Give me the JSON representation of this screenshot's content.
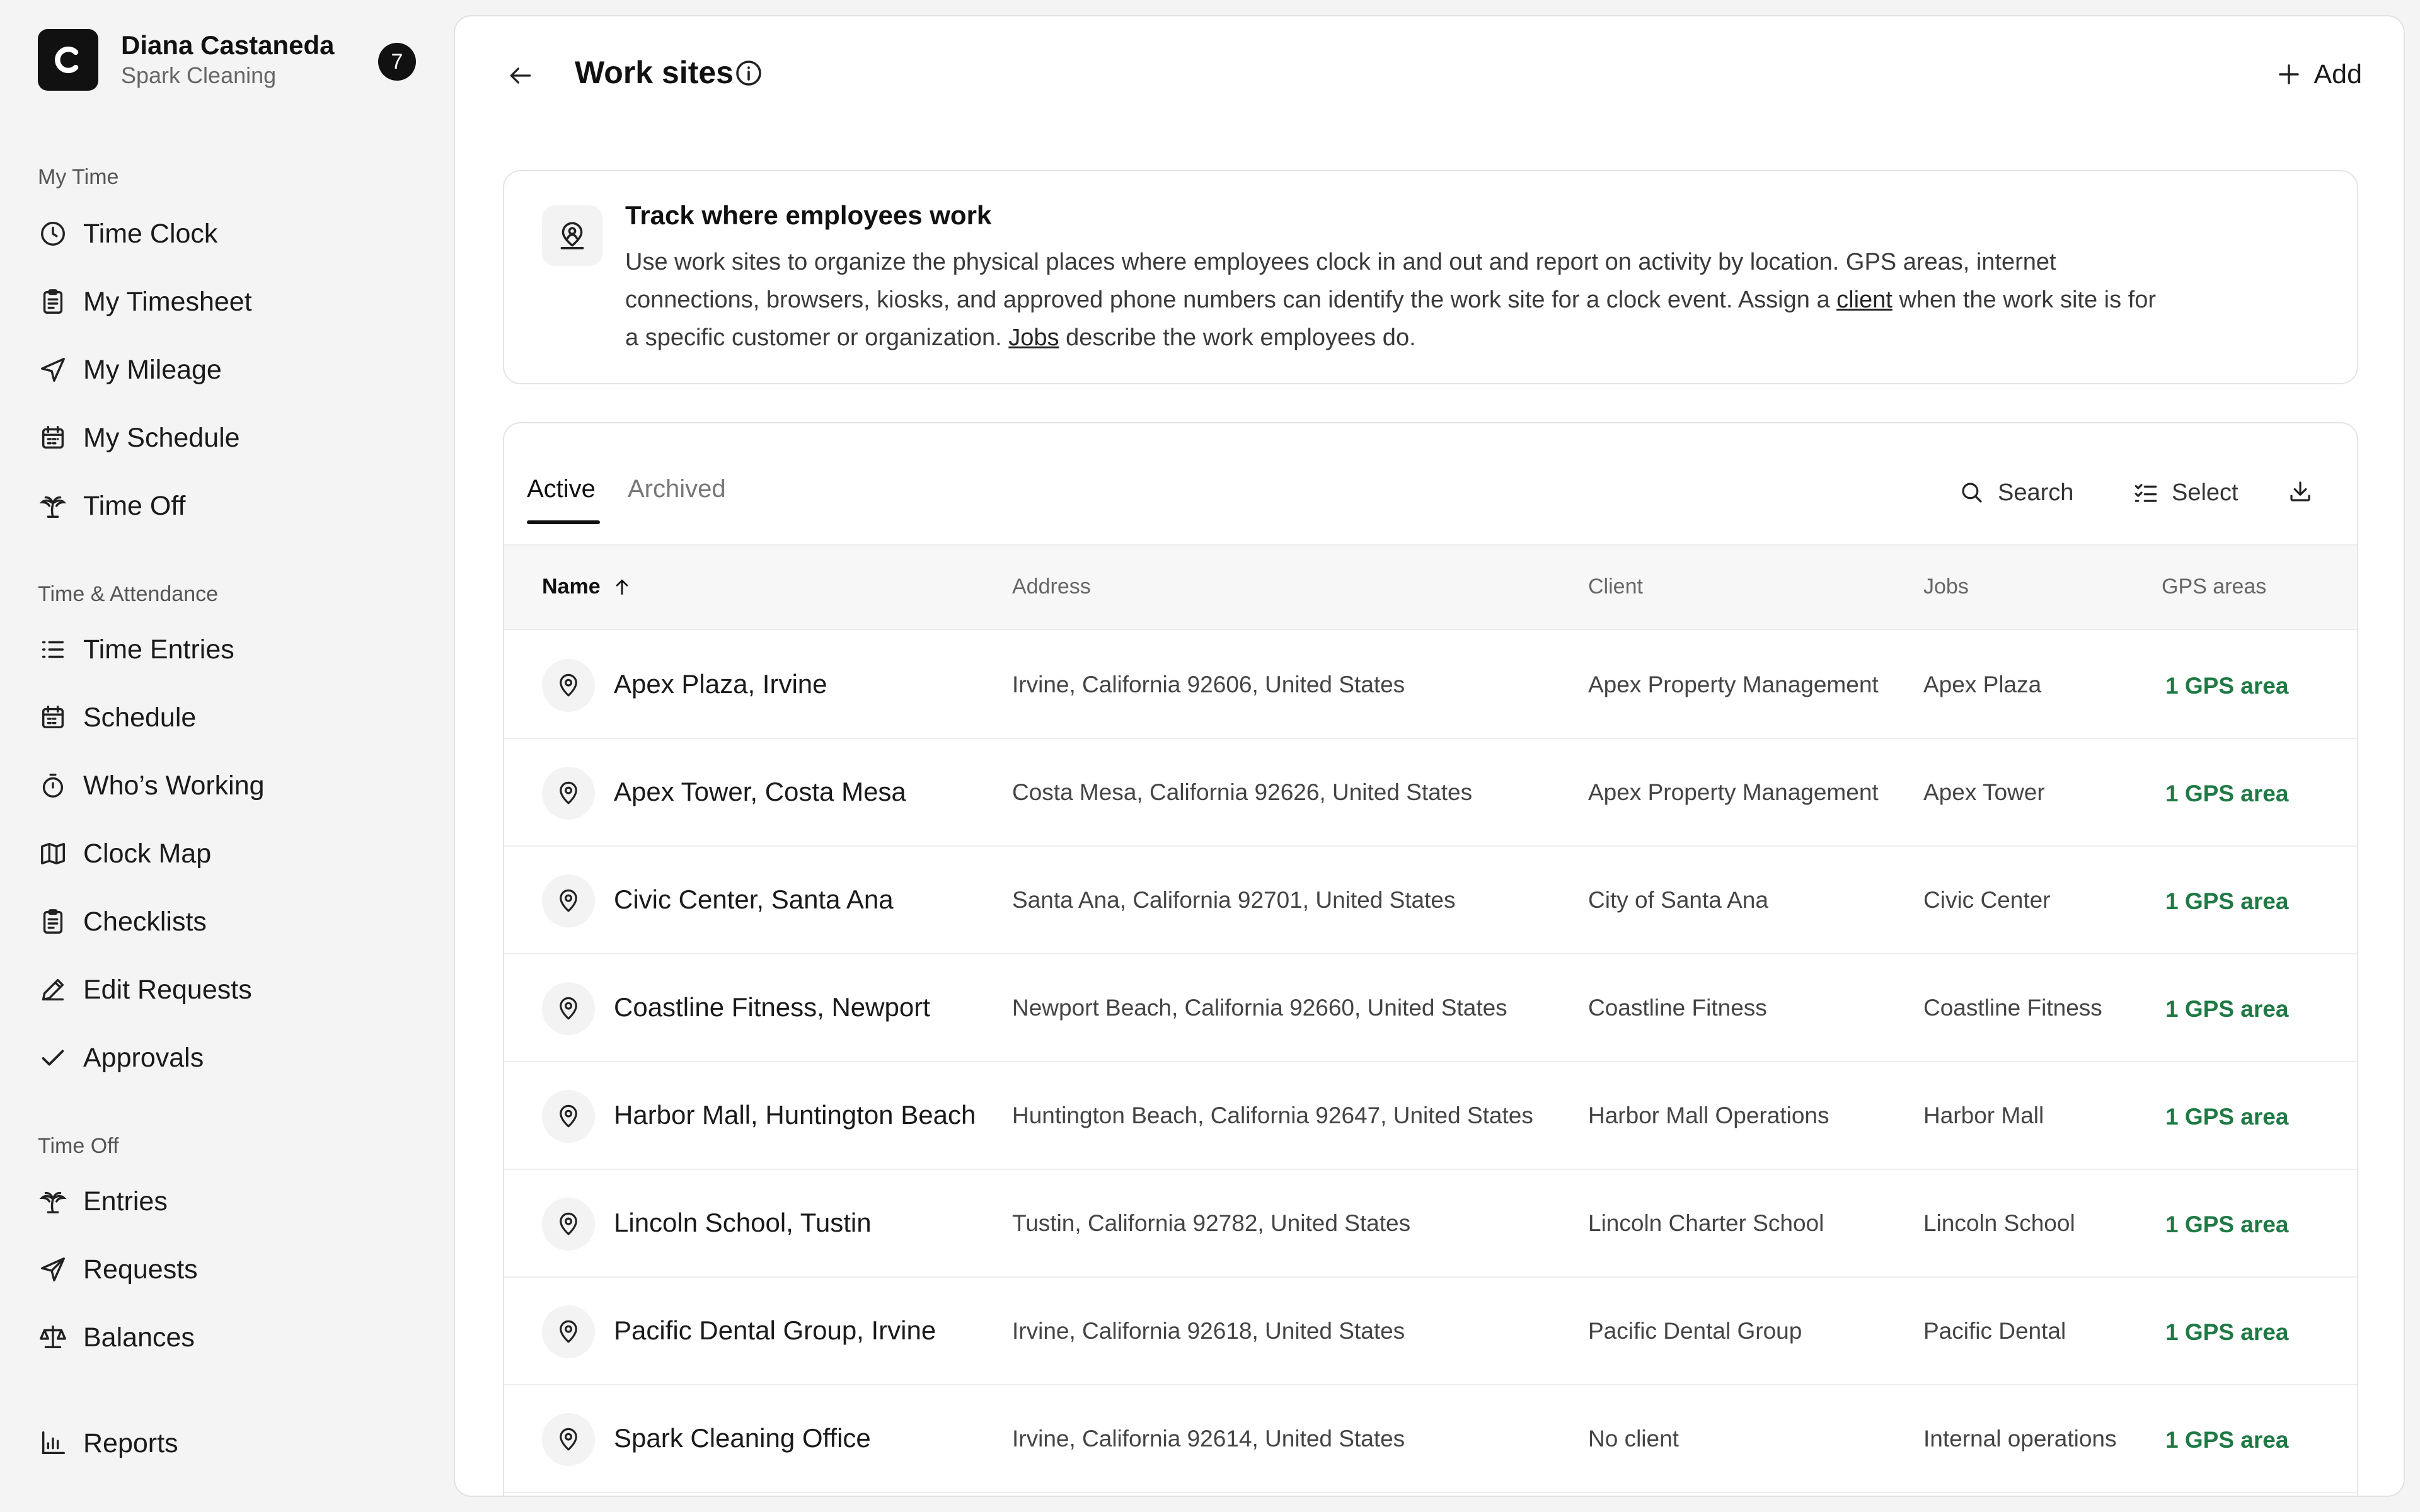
{
  "account": {
    "logo_letter": "C",
    "user_name": "Diana Castaneda",
    "org_name": "Spark Cleaning",
    "notification_count": "7"
  },
  "sidebar": {
    "sections": [
      {
        "label": "My Time",
        "items": [
          {
            "label": "Time Clock",
            "icon": "clock-icon"
          },
          {
            "label": "My Timesheet",
            "icon": "clipboard-icon"
          },
          {
            "label": "My Mileage",
            "icon": "navigation-icon"
          },
          {
            "label": "My Schedule",
            "icon": "calendar-icon"
          },
          {
            "label": "Time Off",
            "icon": "palm-tree-icon"
          }
        ]
      },
      {
        "label": "Time & Attendance",
        "items": [
          {
            "label": "Time Entries",
            "icon": "list-icon"
          },
          {
            "label": "Schedule",
            "icon": "calendar-icon"
          },
          {
            "label": "Who’s Working",
            "icon": "stopwatch-icon"
          },
          {
            "label": "Clock Map",
            "icon": "map-icon"
          },
          {
            "label": "Checklists",
            "icon": "clipboard-check-icon"
          },
          {
            "label": "Edit Requests",
            "icon": "pencil-icon"
          },
          {
            "label": "Approvals",
            "icon": "check-icon"
          }
        ]
      },
      {
        "label": "Time Off",
        "items": [
          {
            "label": "Entries",
            "icon": "palm-tree-icon"
          },
          {
            "label": "Requests",
            "icon": "send-icon"
          },
          {
            "label": "Balances",
            "icon": "scale-icon"
          }
        ]
      }
    ],
    "reports": {
      "label": "Reports",
      "icon": "bar-chart-icon"
    }
  },
  "header": {
    "title": "Work sites",
    "add_label": "Add"
  },
  "banner": {
    "title": "Track where employees work",
    "text_part1": "Use work sites to organize the physical places where employees clock in and out and report on activity by location. GPS areas, internet connections, browsers, kiosks, and approved phone numbers can identify the work site for a clock event. Assign a ",
    "link_client": "client",
    "text_part2": " when the work site is for a specific customer or organization. ",
    "link_jobs": "Jobs",
    "text_part3": " describe the work employees do."
  },
  "tabs": {
    "active": "Active",
    "archived": "Archived"
  },
  "toolbar": {
    "search_label": "Search",
    "select_label": "Select"
  },
  "table": {
    "columns": {
      "name": "Name",
      "address": "Address",
      "client": "Client",
      "jobs": "Jobs",
      "gps": "GPS areas"
    },
    "rows": [
      {
        "name": "Apex Plaza, Irvine",
        "address": "Irvine, California 92606, United States",
        "client": "Apex Property Management",
        "jobs": "Apex Plaza",
        "gps": "1 GPS area"
      },
      {
        "name": "Apex Tower, Costa Mesa",
        "address": "Costa Mesa, California 92626, United States",
        "client": "Apex Property Management",
        "jobs": "Apex Tower",
        "gps": "1 GPS area"
      },
      {
        "name": "Civic Center, Santa Ana",
        "address": "Santa Ana, California 92701, United States",
        "client": "City of Santa Ana",
        "jobs": "Civic Center",
        "gps": "1 GPS area"
      },
      {
        "name": "Coastline Fitness, Newport",
        "address": "Newport Beach, California 92660, United States",
        "client": "Coastline Fitness",
        "jobs": "Coastline Fitness",
        "gps": "1 GPS area"
      },
      {
        "name": "Harbor Mall, Huntington Beach",
        "address": "Huntington Beach, California 92647, United States",
        "client": "Harbor Mall Operations",
        "jobs": "Harbor Mall",
        "gps": "1 GPS area"
      },
      {
        "name": "Lincoln School, Tustin",
        "address": "Tustin, California 92782, United States",
        "client": "Lincoln Charter School",
        "jobs": "Lincoln School",
        "gps": "1 GPS area"
      },
      {
        "name": "Pacific Dental Group, Irvine",
        "address": "Irvine, California 92618, United States",
        "client": "Pacific Dental Group",
        "jobs": "Pacific Dental",
        "gps": "1 GPS area"
      },
      {
        "name": "Spark Cleaning Office",
        "address": "Irvine, California 92614, United States",
        "client": "No client",
        "jobs": "Internal operations",
        "gps": "1 GPS area"
      }
    ]
  },
  "colors": {
    "accent_dark": "#111111",
    "gps_green": "#1e7a44",
    "background": "#f4f4f4"
  }
}
